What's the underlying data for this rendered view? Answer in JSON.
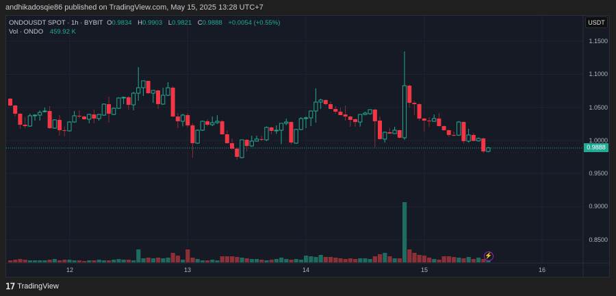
{
  "publisher_line": "andhikadosqie86 published on TradingView.com, May 15, 2025 13:28 UTC+7",
  "legend": {
    "symbol": "ONDOUSDT SPOT · 1h · BYBIT",
    "o_label": "O",
    "o": "0.9834",
    "h_label": "H",
    "h": "0.9903",
    "l_label": "L",
    "l": "0.9821",
    "c_label": "C",
    "c": "0.9888",
    "change": "+0.0054 (+0.55%)",
    "vol_label": "Vol · ONDO",
    "vol": "459.92 K"
  },
  "currency_button": "USDT",
  "price_axis": [
    "1.1500",
    "1.1000",
    "1.0500",
    "1.0000",
    "0.9500",
    "0.9000",
    "0.8500"
  ],
  "last_price": "0.9888",
  "time_axis": [
    "12",
    "13",
    "14",
    "15",
    "16"
  ],
  "footer": {
    "logo_text": "TradingView"
  },
  "colors": {
    "up": "#22ab94",
    "down": "#f23645",
    "up_vol": "#1e6b62",
    "down_vol": "#8c2f36"
  },
  "chart_data": {
    "type": "candlestick",
    "interval": "1h",
    "ylim": [
      0.82,
      1.17
    ],
    "x_ticks": [
      "12",
      "13",
      "14",
      "15",
      "16"
    ],
    "ohlc": [
      [
        1.0631,
        1.0642,
        1.0518,
        1.0528
      ],
      [
        1.0528,
        1.0538,
        1.0362,
        1.0404
      ],
      [
        1.0404,
        1.0414,
        1.0176,
        1.0238
      ],
      [
        1.0238,
        1.0352,
        1.0186,
        1.0217
      ],
      [
        1.0217,
        1.0404,
        1.0207,
        1.0373
      ],
      [
        1.0373,
        1.0393,
        1.03,
        1.0383
      ],
      [
        1.0383,
        1.0455,
        1.03,
        1.0424
      ],
      [
        1.0435,
        1.0497,
        1.0424,
        1.0445
      ],
      [
        1.0445,
        1.0518,
        1.0176,
        1.0186
      ],
      [
        1.0186,
        1.0321,
        1.0176,
        1.0311
      ],
      [
        1.0311,
        1.0383,
        1.0072,
        1.0155
      ],
      [
        1.0155,
        1.0207,
        1.0062,
        1.015
      ],
      [
        1.0145,
        1.029,
        1.0135,
        1.0279
      ],
      [
        1.0279,
        1.0445,
        1.0269,
        1.0373
      ],
      [
        1.0373,
        1.0455,
        1.0331,
        1.0362
      ],
      [
        1.0362,
        1.0373,
        1.0311,
        1.0321
      ],
      [
        1.0321,
        1.0404,
        1.0259,
        1.0393
      ],
      [
        1.0393,
        1.0466,
        1.0259,
        1.0331
      ],
      [
        1.0331,
        1.0404,
        1.03,
        1.0393
      ],
      [
        1.0383,
        1.0559,
        1.0373,
        1.0549
      ],
      [
        1.0549,
        1.0662,
        1.0269,
        1.0404
      ],
      [
        1.0393,
        1.0497,
        1.0383,
        1.0486
      ],
      [
        1.0486,
        1.0652,
        1.0476,
        1.0642
      ],
      [
        1.0642,
        1.0662,
        1.0548,
        1.0652
      ],
      [
        1.0652,
        1.0673,
        1.0466,
        1.0538
      ],
      [
        1.0538,
        1.0735,
        1.0455,
        1.0714
      ],
      [
        1.0714,
        1.1108,
        1.06,
        1.0797
      ],
      [
        1.0797,
        1.0901,
        1.0673,
        1.0901
      ],
      [
        1.0901,
        1.0901,
        1.0704,
        1.0714
      ],
      [
        1.0714,
        1.0756,
        1.0569,
        1.0756
      ],
      [
        1.0756,
        1.0766,
        1.0476,
        1.0549
      ],
      [
        1.0549,
        1.0797,
        1.0538,
        1.0683
      ],
      [
        1.0683,
        1.088,
        1.0673,
        1.0797
      ],
      [
        1.0797,
        1.0818,
        1.0352,
        1.0362
      ],
      [
        1.0362,
        1.0414,
        1.0186,
        1.029
      ],
      [
        1.029,
        1.0404,
        1.0214,
        1.0383
      ],
      [
        1.0383,
        1.0414,
        1.0197,
        1.0228
      ],
      [
        1.0228,
        1.0259,
        0.9741,
        0.9959
      ],
      [
        0.9959,
        1.0166,
        0.9948,
        1.0155
      ],
      [
        1.0155,
        1.03,
        1.0145,
        1.029
      ],
      [
        1.029,
        1.0321,
        1.0217,
        1.0238
      ],
      [
        1.0238,
        1.0362,
        1.0217,
        1.0269
      ],
      [
        1.0269,
        1.038,
        1.025,
        1.029
      ],
      [
        1.029,
        1.031,
        1.0083,
        1.0093
      ],
      [
        1.0093,
        1.0155,
        0.9969,
        0.9959
      ],
      [
        0.9959,
        1.003,
        0.9862,
        0.9876
      ],
      [
        0.9876,
        0.989,
        0.971,
        0.9752
      ],
      [
        0.9741,
        1.001,
        0.973,
        1.001
      ],
      [
        1.001,
        1.002,
        0.9835,
        0.9917
      ],
      [
        0.9917,
        1.0072,
        0.99,
        0.999
      ],
      [
        0.999,
        1.0072,
        0.998,
        1.0021
      ],
      [
        1.0021,
        1.0072,
        0.999,
        1.001
      ],
      [
        1.001,
        1.021,
        0.999,
        1.0197
      ],
      [
        1.0197,
        1.021,
        1.0093,
        1.0145
      ],
      [
        1.0145,
        1.0228,
        1.01,
        1.0155
      ],
      [
        1.0155,
        1.0259,
        0.9945,
        1.0259
      ],
      [
        1.0259,
        1.0331,
        1.023,
        1.0279
      ],
      [
        1.0279,
        1.029,
        0.9938,
        0.9969
      ],
      [
        0.9959,
        1.0176,
        0.9948,
        1.0166
      ],
      [
        1.0166,
        1.0352,
        1.0155,
        1.0331
      ],
      [
        1.0331,
        1.0362,
        1.0186,
        1.0342
      ],
      [
        1.0342,
        1.0455,
        1.0217,
        1.0445
      ],
      [
        1.0445,
        1.0787,
        1.0269,
        1.058
      ],
      [
        1.058,
        1.063,
        1.0476,
        1.0611
      ],
      [
        1.0611,
        1.062,
        1.0528,
        1.0549
      ],
      [
        1.0549,
        1.059,
        1.0476,
        1.0476
      ],
      [
        1.0476,
        1.0518,
        1.0404,
        1.0435
      ],
      [
        1.0435,
        1.0497,
        1.0383,
        1.0383
      ],
      [
        1.0393,
        1.0528,
        1.03,
        1.0362
      ],
      [
        1.0362,
        1.037,
        1.0207,
        1.0311
      ],
      [
        1.0321,
        1.033,
        1.021,
        1.0279
      ],
      [
        1.0279,
        1.038,
        1.021,
        1.0393
      ],
      [
        1.0393,
        1.0435,
        1.038,
        1.0414
      ],
      [
        1.0404,
        1.0466,
        1.039,
        1.0466
      ],
      [
        1.0466,
        1.048,
        0.9897,
        1.029
      ],
      [
        1.03,
        1.036,
        1.001,
        1.0021
      ],
      [
        1.0021,
        1.0135,
        0.9969,
        1.0124
      ],
      [
        1.0124,
        1.019,
        1.01,
        1.0104
      ],
      [
        1.0104,
        1.0207,
        1.01,
        1.0155
      ],
      [
        1.0155,
        1.0165,
        1.003,
        1.0041
      ],
      [
        1.0041,
        1.1346,
        1.001,
        1.0828
      ],
      [
        1.0828,
        1.084,
        1.0497,
        1.0569
      ],
      [
        1.0569,
        1.06,
        1.0383,
        1.0549
      ],
      [
        1.0549,
        1.056,
        1.03,
        1.0331
      ],
      [
        1.0331,
        1.034,
        1.0135,
        1.03
      ],
      [
        1.03,
        1.035,
        1.021,
        1.0293
      ],
      [
        1.029,
        1.0393,
        1.028,
        1.0331
      ],
      [
        1.0331,
        1.0414,
        1.021,
        1.0217
      ],
      [
        1.0217,
        1.0225,
        1.0145,
        1.0155
      ],
      [
        1.0155,
        1.0165,
        1.0055,
        1.0083
      ],
      [
        1.0083,
        1.0135,
        1.0062,
        1.008
      ],
      [
        1.008,
        1.0293,
        1.007,
        1.0279
      ],
      [
        1.0279,
        1.029,
        0.9952,
        0.999
      ],
      [
        0.999,
        1.0176,
        0.9969,
        1.0083
      ],
      [
        1.0083,
        1.011,
        0.999,
        0.9993
      ],
      [
        0.9993,
        1.0045,
        0.9985,
        1.0031
      ],
      [
        1.0031,
        1.004,
        0.981,
        0.9834
      ],
      [
        0.9834,
        0.9903,
        0.9821,
        0.9888
      ]
    ],
    "volume_k": [
      450,
      600,
      750,
      600,
      450,
      450,
      450,
      450,
      600,
      750,
      450,
      600,
      600,
      450,
      450,
      300,
      450,
      450,
      600,
      450,
      450,
      600,
      750,
      600,
      600,
      450,
      2850,
      900,
      1050,
      900,
      1050,
      900,
      1050,
      2100,
      1500,
      600,
      2850,
      1050,
      750,
      450,
      450,
      600,
      450,
      1350,
      1350,
      1350,
      1200,
      1050,
      900,
      750,
      750,
      600,
      450,
      600,
      750,
      1050,
      750,
      600,
      750,
      600,
      1500,
      1350,
      1200,
      1650,
      1200,
      1200,
      1050,
      900,
      750,
      900,
      750,
      900,
      900,
      750,
      1350,
      1800,
      2100,
      1350,
      900,
      900,
      13200,
      2850,
      2100,
      1650,
      1500,
      1050,
      750,
      600,
      1350,
      1350,
      1200,
      1050,
      900,
      1200,
      750,
      1050,
      750,
      460
    ]
  }
}
